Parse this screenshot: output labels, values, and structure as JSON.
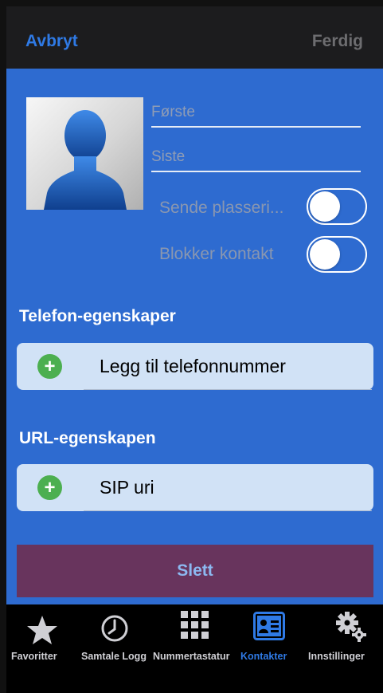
{
  "navbar": {
    "cancel_label": "Avbryt",
    "done_label": "Ferdig"
  },
  "form": {
    "first_placeholder": "Første",
    "last_placeholder": "Siste",
    "send_location_label": "Sende plasseri...",
    "block_contact_label": "Blokker kontakt",
    "send_location_on": false,
    "block_contact_on": false
  },
  "sections": {
    "phone_title": "Telefon-egenskaper",
    "add_phone_label": "Legg til telefonnummer",
    "url_title": "URL-egenskapen",
    "sip_label": "SIP uri"
  },
  "delete_label": "Slett",
  "tabs": [
    {
      "label": "Favoritter",
      "icon": "star-icon",
      "active": false
    },
    {
      "label": "Samtale Logg",
      "icon": "clock-icon",
      "active": false
    },
    {
      "label": "Nummertastatur",
      "icon": "keypad-icon",
      "active": false
    },
    {
      "label": "Kontakter",
      "icon": "contact-card-icon",
      "active": true
    },
    {
      "label": "Innstillinger",
      "icon": "gears-icon",
      "active": false
    }
  ],
  "colors": {
    "accent": "#2f7ae5",
    "content_bg": "#2e6bd0",
    "delete_bg": "#68345d",
    "add_green": "#4caf50",
    "tab_active": "#2f7ae5",
    "tab_inactive": "#cfcfd4"
  }
}
